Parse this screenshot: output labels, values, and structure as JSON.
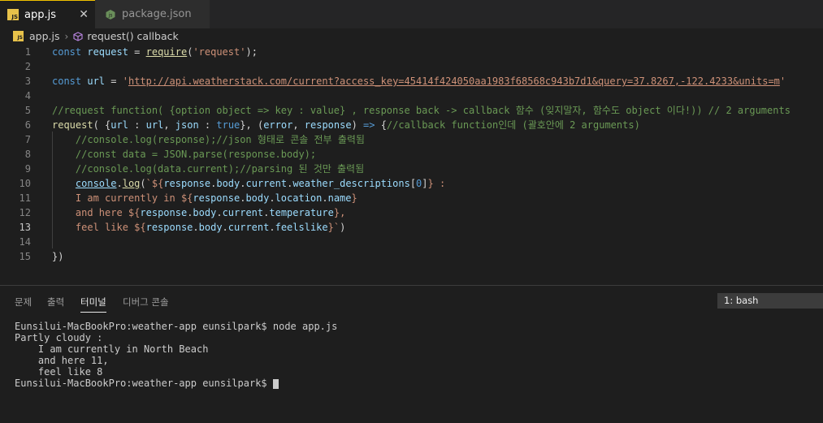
{
  "tabs": [
    {
      "label": "app.js",
      "icon": "js-file-icon",
      "active": true
    },
    {
      "label": "package.json",
      "icon": "nodejs-icon",
      "active": false
    }
  ],
  "breadcrumb": {
    "file": "app.js",
    "symbol": "request() callback"
  },
  "code_lines": [
    {
      "n": "1",
      "html": "<span class='kw'>const</span> <span class='vr'>request</span> = <span class='fn ul'>require</span>(<span class='st'>'request'</span>);"
    },
    {
      "n": "2",
      "html": ""
    },
    {
      "n": "3",
      "html": "<span class='kw'>const</span> <span class='vr'>url</span> = <span class='st'>'<span class=\"ul\">http://api.weatherstack.com/current?access_key=45414f424050aa1983f68568c943b7d1&amp;query=37.8267,-122.4233&amp;units=m</span>'</span>"
    },
    {
      "n": "4",
      "html": ""
    },
    {
      "n": "5",
      "html": "<span class='cm'>//request function( {option object =&gt; key : value} , response back -&gt; callback 함수 (잊지말자, 함수도 object 이다!)) // 2 arguments</span>"
    },
    {
      "n": "6",
      "html": "<span class='fn'>request</span>( {<span class='vr'>url</span> : <span class='vr'>url</span>, <span class='vr'>json</span> : <span class='kw'>true</span>}, (<span class='vr'>error</span>, <span class='vr'>response</span>) <span class='kw'>=&gt;</span> {<span class='cm'>//callback function인데 (괄호안에 2 arguments)</span>"
    },
    {
      "n": "7",
      "html": "    <span class='cm'>//console.log(response);//json 형태로 콘솔 전부 출력됨</span>"
    },
    {
      "n": "8",
      "html": "    <span class='cm'>//const data = JSON.parse(response.body);</span>"
    },
    {
      "n": "9",
      "html": "    <span class='cm'>//console.log(data.current);//parsing 된 것만 출력됨</span>"
    },
    {
      "n": "10",
      "html": "    <span class='vr ul'>console</span>.<span class='fn ul'>log</span>(<span class='st'>`${</span><span class='vr'>response</span>.<span class='vr'>body</span>.<span class='vr'>current</span>.<span class='vr'>weather_descriptions</span>[<span class='kw'>0</span>]<span class='st'>} :</span>"
    },
    {
      "n": "11",
      "html": "    <span class='st'>I am currently in ${</span><span class='vr'>response</span>.<span class='vr'>body</span>.<span class='vr'>location</span>.<span class='vr'>name</span><span class='st'>}</span>"
    },
    {
      "n": "12",
      "html": "    <span class='st'>and here ${</span><span class='vr'>response</span>.<span class='vr'>body</span>.<span class='vr'>current</span>.<span class='vr'>temperature</span><span class='st'>},</span>"
    },
    {
      "n": "13",
      "html": "    <span class='st'>feel like ${</span><span class='vr'>response</span>.<span class='vr'>body</span>.<span class='vr'>current</span>.<span class='vr'>feelslike</span><span class='st'>}`</span>)"
    },
    {
      "n": "14",
      "html": ""
    },
    {
      "n": "15",
      "html": "})"
    }
  ],
  "panel": {
    "tabs": [
      "문제",
      "출력",
      "터미널",
      "디버그 콘솔"
    ],
    "active_tab": "터미널",
    "terminal_select": "1: bash",
    "terminal_lines": [
      "Eunsilui-MacBookPro:weather-app eunsilpark$ node app.js",
      "Partly cloudy :",
      "    I am currently in North Beach",
      "    and here 11,",
      "    feel like 8",
      "Eunsilui-MacBookPro:weather-app eunsilpark$"
    ]
  },
  "colors": {
    "accent": "#f0c000",
    "background": "#1e1e1e",
    "keyword": "#569cd6",
    "string": "#ce9178",
    "comment": "#6a9955"
  }
}
